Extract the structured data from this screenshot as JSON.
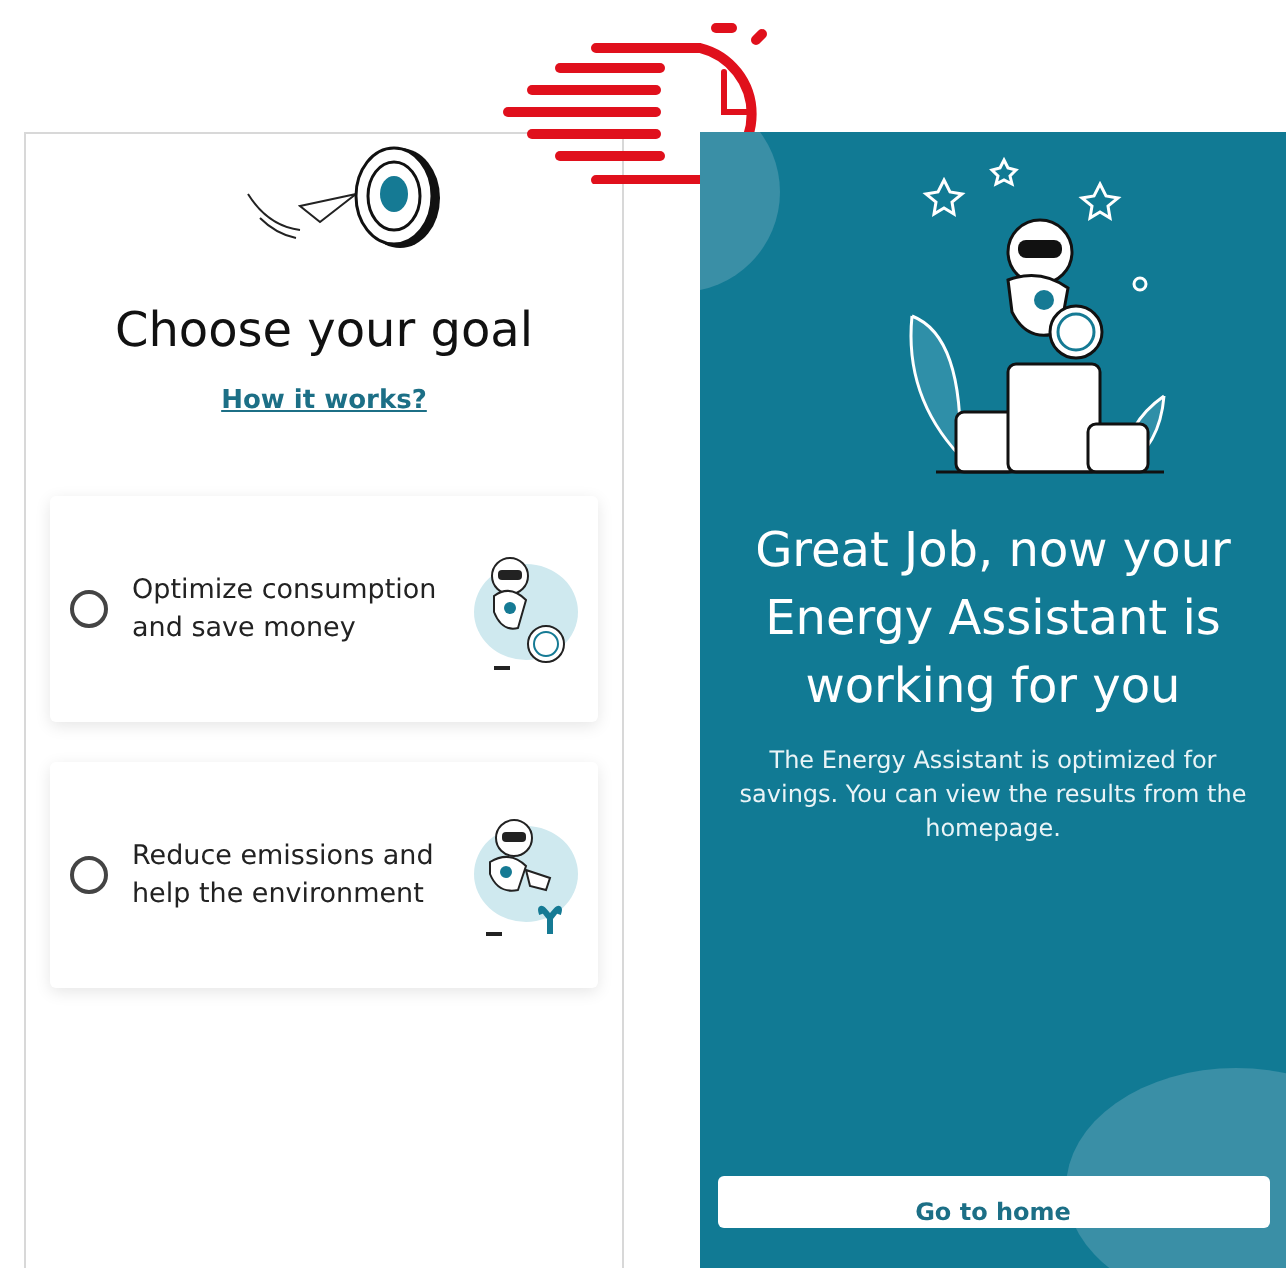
{
  "goal_screen": {
    "title": "Choose your goal",
    "link": "How it works?",
    "options": [
      {
        "label": "Optimize consumption and save money",
        "selected": false,
        "kind": "savings"
      },
      {
        "label": "Reduce emissions and help the environment",
        "selected": false,
        "kind": "environment"
      }
    ]
  },
  "success_screen": {
    "title": "Great Job, now your Energy Assistant is working for you",
    "message": "The Energy Assistant is optimized for savings. You can view the results from the homepage.",
    "button": "Go to home"
  }
}
